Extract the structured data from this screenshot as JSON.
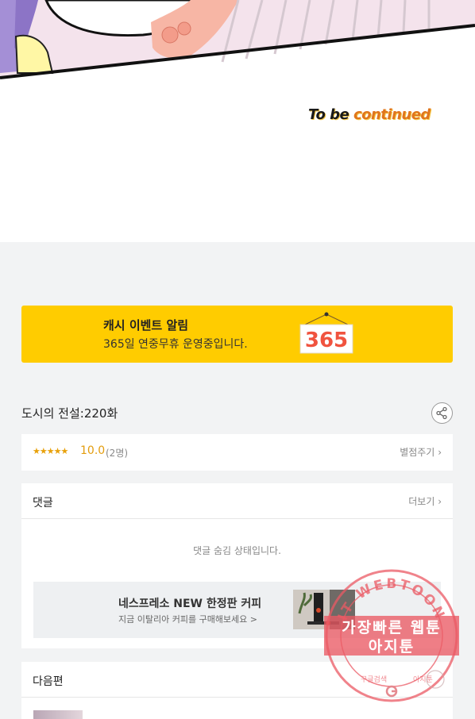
{
  "comic": {
    "to_be": "To be ",
    "continued": "continued"
  },
  "banner": {
    "title": "캐시 이벤트 알림",
    "subtitle": "365일 연중무휴 운영중입니다.",
    "calendar_number": "365"
  },
  "episode": {
    "title": "도시의 전설:220화",
    "share_icon": "share-icon"
  },
  "rating": {
    "stars": "★★★★★",
    "score": "10.0",
    "count": "(2명)",
    "rate_link": "별점주기",
    "star_fraction": 1.0
  },
  "comments": {
    "title": "댓글",
    "more": "더보기",
    "hidden_message": "댓글 숨김 상태입니다."
  },
  "ad": {
    "title": "네스프레소 NEW 한정판 커피",
    "subtitle": "지금 이탈리아 커피를 구매해보세요 >"
  },
  "next": {
    "title": "다음편"
  },
  "watermark": {
    "ring_text": "IT WEBTOON",
    "line1": "가장빠른 웹툰",
    "line2": "아지툰",
    "bottom_left": "구글검색",
    "bottom_right": "아지툰"
  },
  "colors": {
    "banner_yellow": "#ffcc00",
    "rating_orange": "#e39c0d",
    "watermark_red": "#eb5a64",
    "page_bg": "#f2f3f4"
  }
}
